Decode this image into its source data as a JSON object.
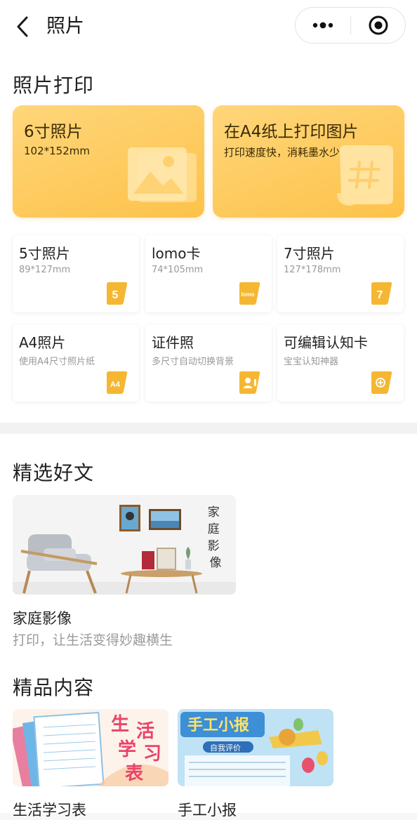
{
  "nav": {
    "title": "照片"
  },
  "print_section": {
    "title": "照片打印",
    "big_cards": [
      {
        "title": "6寸照片",
        "subtitle": "102*152mm",
        "icon": "image-icon"
      },
      {
        "title": "在A4纸上打印图片",
        "subtitle": "打印速度快，消耗墨水少",
        "icon": "hash-document-icon"
      }
    ],
    "small_cards": [
      {
        "title": "5寸照片",
        "subtitle": "89*127mm",
        "badge": "5"
      },
      {
        "title": "lomo卡",
        "subtitle": "74*105mm",
        "badge": "lomo"
      },
      {
        "title": "7寸照片",
        "subtitle": "127*178mm",
        "badge": "7"
      },
      {
        "title": "A4照片",
        "subtitle": "使用A4尺寸照片纸",
        "badge": "A4"
      },
      {
        "title": "证件照",
        "subtitle": "多尺寸自动切换背景",
        "badge": "id-photo-icon"
      },
      {
        "title": "可编辑认知卡",
        "subtitle": "宝宝认知神器",
        "badge": "plus-circle-icon"
      }
    ]
  },
  "articles_section": {
    "title": "精选好文",
    "article": {
      "image_text": "家庭影像",
      "title": "家庭影像",
      "subtitle": "打印，让生活变得妙趣横生"
    }
  },
  "premium_section": {
    "title": "精品内容",
    "items": [
      {
        "label": "生活学习表",
        "image_text": "生活学习表"
      },
      {
        "label": "手工小报",
        "image_text": "手工小报",
        "image_subtext": "自我评价"
      }
    ]
  },
  "colors": {
    "card_yellow": "#fdc24a",
    "card_yellow_light": "#ffd67a",
    "badge_orange": "#f5b731"
  }
}
